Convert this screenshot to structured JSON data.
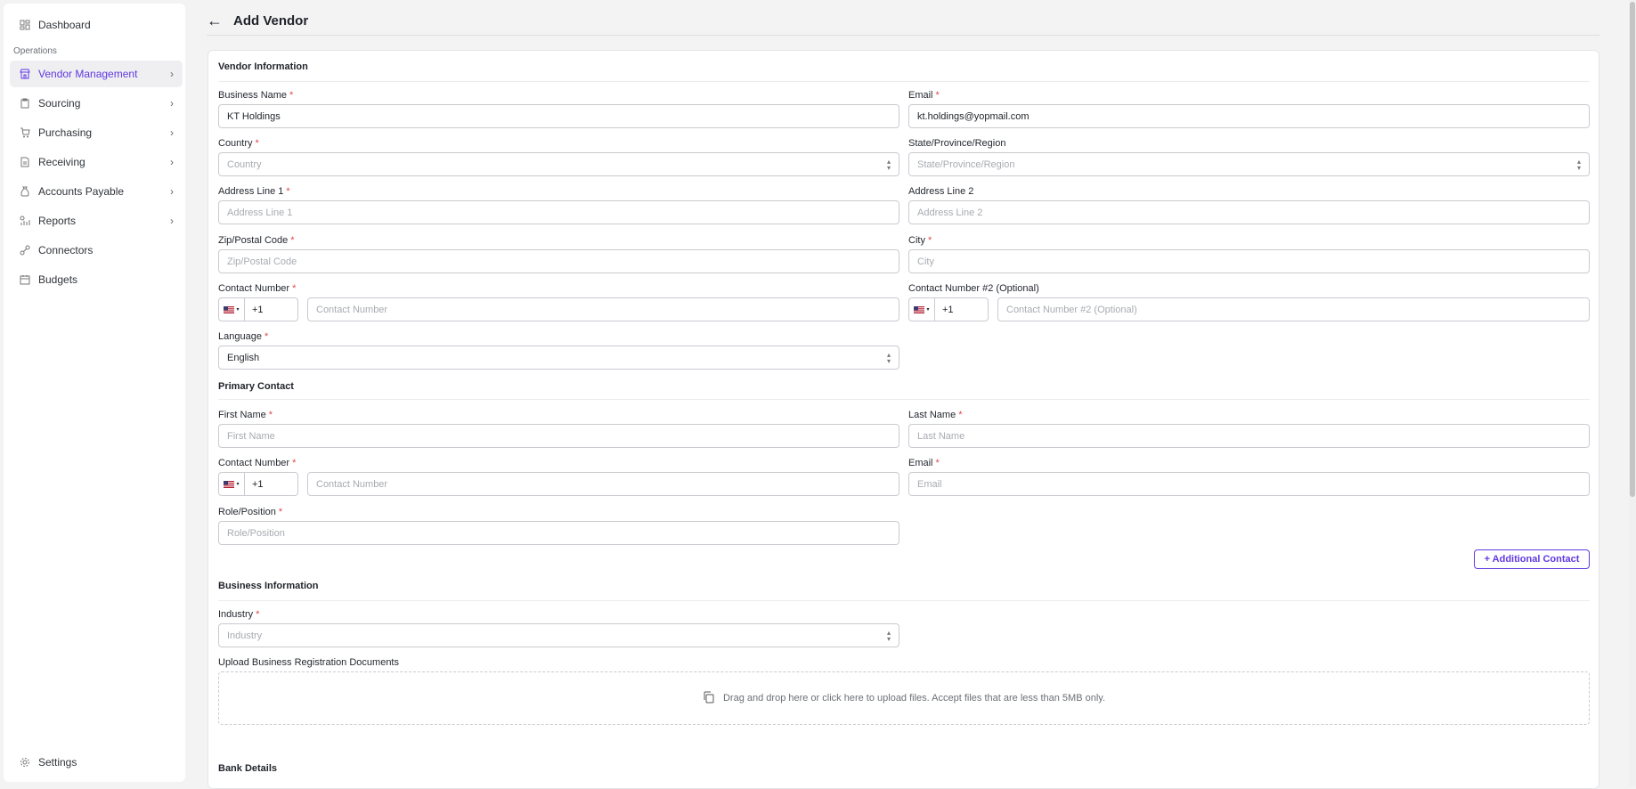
{
  "sidebar": {
    "dashboard": "Dashboard",
    "section": "Operations",
    "items": [
      {
        "label": "Vendor Management"
      },
      {
        "label": "Sourcing"
      },
      {
        "label": "Purchasing"
      },
      {
        "label": "Receiving"
      },
      {
        "label": "Accounts Payable"
      },
      {
        "label": "Reports"
      },
      {
        "label": "Connectors"
      },
      {
        "label": "Budgets"
      }
    ],
    "settings": "Settings"
  },
  "header": {
    "title": "Add Vendor"
  },
  "vendor_info": {
    "title": "Vendor Information",
    "business_name": {
      "label": "Business Name",
      "value": "KT Holdings"
    },
    "email": {
      "label": "Email",
      "value": "kt.holdings@yopmail.com"
    },
    "country": {
      "label": "Country",
      "placeholder": "Country"
    },
    "state": {
      "label": "State/Province/Region",
      "placeholder": "State/Province/Region"
    },
    "address1": {
      "label": "Address Line 1",
      "placeholder": "Address Line 1"
    },
    "address2": {
      "label": "Address Line 2",
      "placeholder": "Address Line 2"
    },
    "zip": {
      "label": "Zip/Postal Code",
      "placeholder": "Zip/Postal Code"
    },
    "city": {
      "label": "City",
      "placeholder": "City"
    },
    "contact": {
      "label": "Contact Number",
      "code": "+1",
      "placeholder": "Contact Number"
    },
    "contact2": {
      "label": "Contact Number #2 (Optional)",
      "code": "+1",
      "placeholder": "Contact Number #2 (Optional)"
    },
    "language": {
      "label": "Language",
      "value": "English"
    }
  },
  "primary_contact": {
    "title": "Primary Contact",
    "first_name": {
      "label": "First Name",
      "placeholder": "First Name"
    },
    "last_name": {
      "label": "Last Name",
      "placeholder": "Last Name"
    },
    "contact": {
      "label": "Contact Number",
      "code": "+1",
      "placeholder": "Contact Number"
    },
    "email": {
      "label": "Email",
      "placeholder": "Email"
    },
    "role": {
      "label": "Role/Position",
      "placeholder": "Role/Position"
    },
    "add_button": "+ Additional Contact"
  },
  "business_info": {
    "title": "Business Information",
    "industry": {
      "label": "Industry",
      "placeholder": "Industry"
    },
    "upload": {
      "label": "Upload Business Registration Documents",
      "text": "Drag and drop here or click here to upload files. Accept files that are less than 5MB only."
    }
  },
  "bank": {
    "title": "Bank Details"
  },
  "required_mark": "*",
  "colors": {
    "accent": "#6138e1",
    "required": "#e04848"
  }
}
